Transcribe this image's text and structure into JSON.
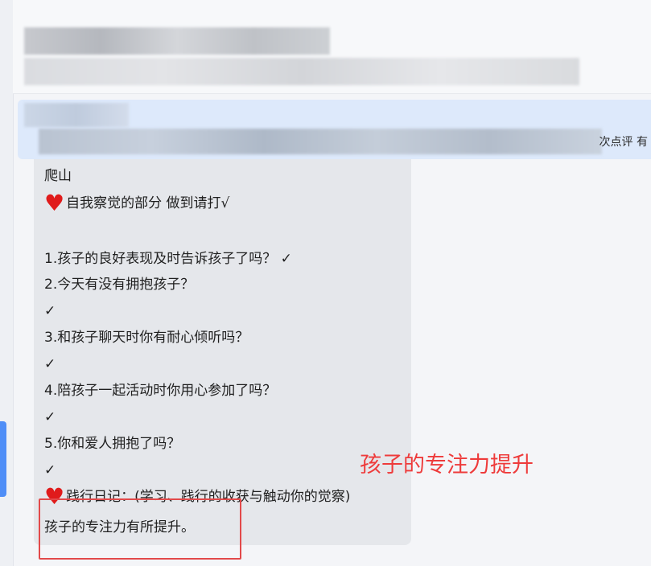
{
  "header": {
    "blurred": true
  },
  "banner": {
    "tail_text": "次点评 有"
  },
  "message": {
    "lines": [
      "爬山",
      "自我察觉的部分 做到请打√",
      "",
      "1.孩子的良好表现及时告诉孩子了吗？ ✓",
      "2.今天有没有拥抱孩子？",
      "✓",
      "3.和孩子聊天时你有耐心倾听吗？",
      "✓",
      "4.陪孩子一起活动时你用心参加了吗？",
      "✓",
      "5.你和爱人拥抱了吗？",
      "✓",
      "践行日记：(学习、践行的收获与触动你的觉察)",
      "孩子的专注力有所提升。"
    ],
    "heart_icon": "heart-icon"
  },
  "annotation": {
    "label": "孩子的专注力提升",
    "color": "#ee3b3b"
  }
}
